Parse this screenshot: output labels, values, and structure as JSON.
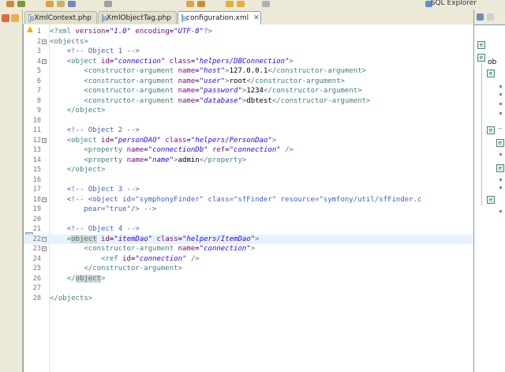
{
  "toolbar": {
    "perspective_label": "SQL Explorer"
  },
  "tabs": [
    {
      "label": "XmlContext.php",
      "active": false
    },
    {
      "label": "XmlObjectTag.php",
      "active": false
    },
    {
      "label": "configuration.xml",
      "active": true,
      "close": "✕"
    }
  ],
  "editor": {
    "current_line": 22,
    "lines": [
      {
        "n": "1",
        "fold": "",
        "html": "<span class='tag'>&lt;?xml</span> <span class='attr'>version</span>=<span class='val'>\"1.0\"</span> <span class='attr'>encoding</span>=<span class='val'>\"UTF-8\"</span><span class='tag'>?&gt;</span>"
      },
      {
        "n": "2",
        "fold": "−",
        "html": "<span class='tag'>&lt;objects&gt;</span>"
      },
      {
        "n": "3",
        "fold": "",
        "html": "    <span class='cmt'>&lt;!-- Object 1 --&gt;</span>"
      },
      {
        "n": "4",
        "fold": "−",
        "html": "    <span class='tag'>&lt;object</span> <span class='attr'>id</span>=<span class='val'>\"connection\"</span> <span class='attr'>class</span>=<span class='val'>\"helpers/DBConnection\"</span><span class='tag'>&gt;</span>"
      },
      {
        "n": "5",
        "fold": "",
        "html": "        <span class='tag'>&lt;constructor-argument</span> <span class='attr'>name</span>=<span class='val'>\"host\"</span><span class='tag'>&gt;</span>127.0.0.1<span class='tag'>&lt;/constructor-argument&gt;</span>"
      },
      {
        "n": "6",
        "fold": "",
        "html": "        <span class='tag'>&lt;constructor-argument</span> <span class='attr'>name</span>=<span class='val'>\"user\"</span><span class='tag'>&gt;</span>root<span class='tag'>&lt;/constructor-argument&gt;</span>"
      },
      {
        "n": "7",
        "fold": "",
        "html": "        <span class='tag'>&lt;constructor-argument</span> <span class='attr'>name</span>=<span class='val'>\"password\"</span><span class='tag'>&gt;</span>1234<span class='tag'>&lt;/constructor-argument&gt;</span>"
      },
      {
        "n": "8",
        "fold": "",
        "html": "        <span class='tag'>&lt;constructor-argument</span> <span class='attr'>name</span>=<span class='val'>\"database\"</span><span class='tag'>&gt;</span>dbtest<span class='tag'>&lt;/constructor-argument&gt;</span>"
      },
      {
        "n": "9",
        "fold": "",
        "html": "    <span class='tag'>&lt;/object&gt;</span>"
      },
      {
        "n": "10",
        "fold": "",
        "html": ""
      },
      {
        "n": "11",
        "fold": "",
        "html": "    <span class='cmt'>&lt;!-- Object 2 --&gt;</span>"
      },
      {
        "n": "12",
        "fold": "−",
        "html": "    <span class='tag'>&lt;object</span> <span class='attr'>id</span>=<span class='val'>\"personDAO\"</span> <span class='attr'>class</span>=<span class='val'>\"helpers/PersonDao\"</span><span class='tag'>&gt;</span>"
      },
      {
        "n": "13",
        "fold": "",
        "html": "        <span class='tag'>&lt;property</span> <span class='attr'>name</span>=<span class='val'>\"connectionDb\"</span> <span class='attr'>ref</span>=<span class='val'>\"connection\"</span> <span class='tag'>/&gt;</span>"
      },
      {
        "n": "14",
        "fold": "",
        "html": "        <span class='tag'>&lt;property</span> <span class='attr'>name</span>=<span class='val'>\"name\"</span><span class='tag'>&gt;</span>admin<span class='tag'>&lt;/property&gt;</span>"
      },
      {
        "n": "15",
        "fold": "",
        "html": "    <span class='tag'>&lt;/object&gt;</span>"
      },
      {
        "n": "16",
        "fold": "",
        "html": ""
      },
      {
        "n": "17",
        "fold": "",
        "html": "    <span class='cmt'>&lt;!-- Object 3 --&gt;</span>"
      },
      {
        "n": "18",
        "fold": "−",
        "html": "    <span class='cmt'>&lt;!-- &lt;object id=\"symphonyFinder\" class=\"sfFinder\" resource=\"symfony/util/sfFinder.c</span>"
      },
      {
        "n": "19",
        "fold": "",
        "html": "<span class='cmt'>        pear=\"true\"/&gt; --&gt;</span>"
      },
      {
        "n": "20",
        "fold": "",
        "html": ""
      },
      {
        "n": "21",
        "fold": "",
        "html": "    <span class='cmt'>&lt;!-- Object 4 --&gt;</span>"
      },
      {
        "n": "22",
        "fold": "−",
        "html": "    <span class='tag'>&lt;<span class='match'>object</span></span> <span class='attr'>id</span>=<span class='val'>\"itemDao\"</span> <span class='attr'>class</span>=<span class='val'>\"helpers/ItemDao\"</span><span class='tag'>&gt;</span>"
      },
      {
        "n": "23",
        "fold": "−",
        "html": "        <span class='tag'>&lt;constructor-argument</span> <span class='attr'>name</span>=<span class='val'>\"connection\"</span><span class='tag'>&gt;</span>"
      },
      {
        "n": "24",
        "fold": "",
        "html": "            <span class='tag'>&lt;ref</span> <span class='attr'>id</span>=<span class='val'>\"connection\"</span> <span class='tag'>/&gt;</span>"
      },
      {
        "n": "25",
        "fold": "",
        "html": "        <span class='tag'>&lt;/constructor-argument&gt;</span>"
      },
      {
        "n": "26",
        "fold": "",
        "html": "    <span class='tag'>&lt;/<span class='match'>object</span>&gt;</span>"
      },
      {
        "n": "27",
        "fold": "",
        "html": ""
      },
      {
        "n": "28",
        "fold": "",
        "html": "<span class='tag'>&lt;/objects&gt;</span>"
      }
    ]
  },
  "outline": {
    "root_label": "ob"
  },
  "colors": {
    "tag": "#3f7f7f",
    "attr": "#7f007f",
    "value": "#2a00ff",
    "comment": "#3f5fbf",
    "current_line": "#e8f2fe"
  }
}
